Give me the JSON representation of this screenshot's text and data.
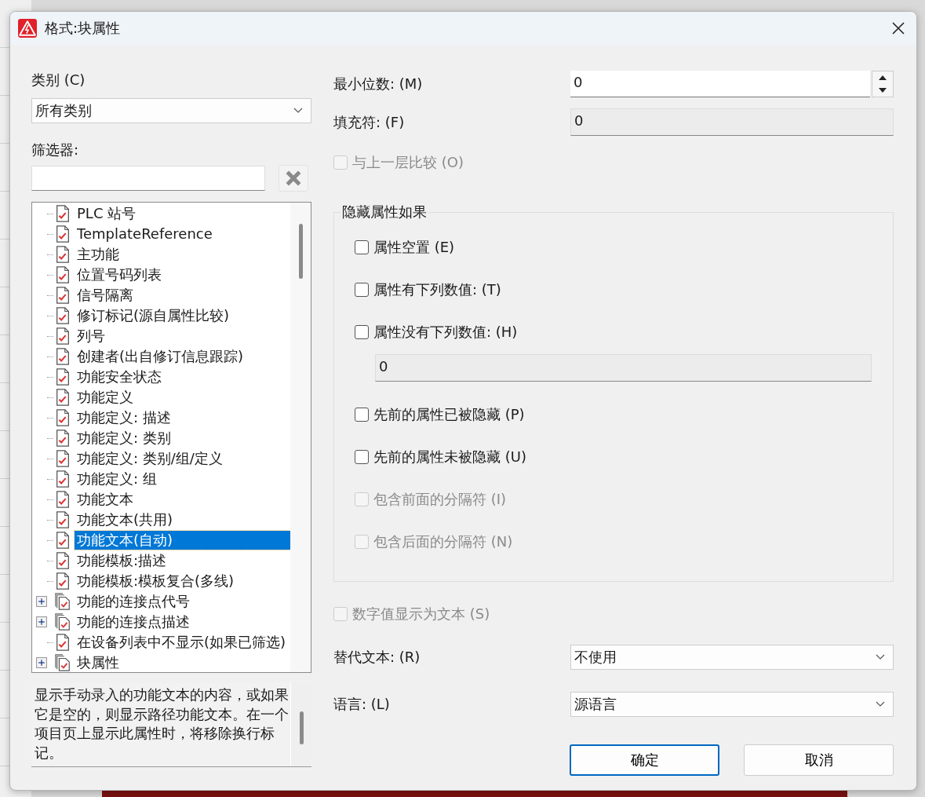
{
  "window": {
    "title": "格式:块属性"
  },
  "category": {
    "label": "类别 (C)",
    "value": "所有类别"
  },
  "filter": {
    "label": "筛选器:"
  },
  "tree": [
    {
      "label": "PLC 站号",
      "kind": "leaf",
      "selected": false
    },
    {
      "label": "TemplateReference",
      "kind": "leaf",
      "selected": false
    },
    {
      "label": "主功能",
      "kind": "leaf",
      "selected": false
    },
    {
      "label": "位置号码列表",
      "kind": "leaf",
      "selected": false
    },
    {
      "label": "信号隔离",
      "kind": "leaf",
      "selected": false
    },
    {
      "label": "修订标记(源自属性比较)",
      "kind": "leaf",
      "selected": false
    },
    {
      "label": "列号",
      "kind": "leaf",
      "selected": false
    },
    {
      "label": "创建者(出自修订信息跟踪)",
      "kind": "leaf",
      "selected": false
    },
    {
      "label": "功能安全状态",
      "kind": "leaf",
      "selected": false
    },
    {
      "label": "功能定义",
      "kind": "leaf",
      "selected": false
    },
    {
      "label": "功能定义: 描述",
      "kind": "leaf",
      "selected": false
    },
    {
      "label": "功能定义: 类别",
      "kind": "leaf",
      "selected": false
    },
    {
      "label": "功能定义: 类别/组/定义",
      "kind": "leaf",
      "selected": false
    },
    {
      "label": "功能定义: 组",
      "kind": "leaf",
      "selected": false
    },
    {
      "label": "功能文本",
      "kind": "leaf",
      "selected": false
    },
    {
      "label": "功能文本(共用)",
      "kind": "leaf",
      "selected": false
    },
    {
      "label": "功能文本(自动)",
      "kind": "leaf",
      "selected": true
    },
    {
      "label": "功能模板:描述",
      "kind": "leaf",
      "selected": false
    },
    {
      "label": "功能模板:模板复合(多线)",
      "kind": "leaf",
      "selected": false
    },
    {
      "label": "功能的连接点代号",
      "kind": "group",
      "expanded": false,
      "selected": false
    },
    {
      "label": "功能的连接点描述",
      "kind": "group",
      "expanded": false,
      "selected": false
    },
    {
      "label": "在设备列表中不显示(如果已筛选)",
      "kind": "leaf",
      "selected": false
    },
    {
      "label": "块属性",
      "kind": "group",
      "expanded": false,
      "selected": false
    }
  ],
  "description": "显示手动录入的功能文本的内容，或如果它是空的，则显示路径功能文本。在一个项目页上显示此属性时，将移除换行标记。",
  "fields": [
    {
      "kind": "spin",
      "label": "最小位数: (M)",
      "value": "0",
      "disabled": false
    },
    {
      "kind": "text",
      "label": "填充符: (F)",
      "value": "0",
      "disabled": true
    }
  ],
  "compare": {
    "label": "与上一层比较 (O)",
    "checked": false,
    "disabled": true
  },
  "hide_group": {
    "title": "隐藏属性如果",
    "options": [
      {
        "kind": "checkbox",
        "label": "属性空置 (E)",
        "checked": false,
        "disabled": false
      },
      {
        "kind": "checkbox",
        "label": "属性有下列数值: (T)",
        "checked": false,
        "disabled": false
      },
      {
        "kind": "checkbox",
        "label": "属性没有下列数值: (H)",
        "checked": false,
        "disabled": false
      },
      {
        "kind": "field",
        "value": "0",
        "disabled": true
      },
      {
        "kind": "checkbox",
        "label": "先前的属性已被隐藏 (P)",
        "checked": false,
        "disabled": false
      },
      {
        "kind": "checkbox",
        "label": "先前的属性未被隐藏 (U)",
        "checked": false,
        "disabled": false
      },
      {
        "kind": "checkbox",
        "label": "包含前面的分隔符 (I)",
        "checked": false,
        "disabled": true
      },
      {
        "kind": "checkbox",
        "label": "包含后面的分隔符 (N)",
        "checked": false,
        "disabled": true
      }
    ]
  },
  "numeric_as_text": {
    "label": "数字值显示为文本 (S)",
    "checked": false,
    "disabled": true
  },
  "dropdowns": [
    {
      "label": "替代文本: (R)",
      "value": "不使用"
    },
    {
      "label": "语言: (L)",
      "value": "源语言"
    }
  ],
  "buttons": [
    {
      "label": "确定",
      "default": true
    },
    {
      "label": "取消",
      "default": false
    }
  ]
}
